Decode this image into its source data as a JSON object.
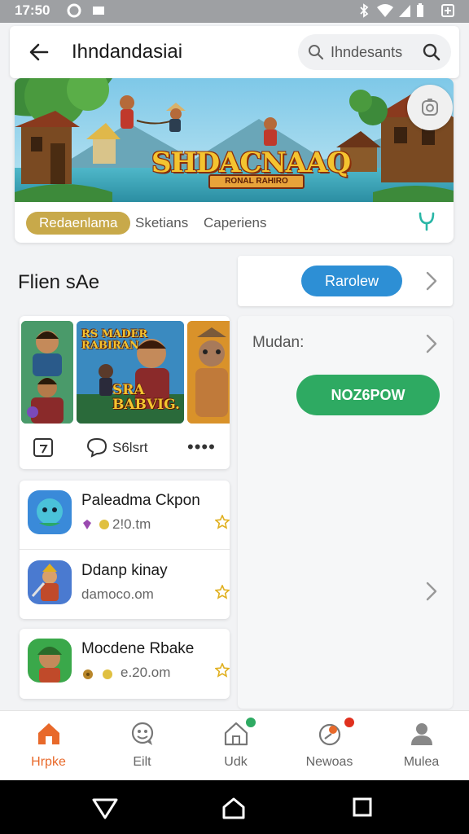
{
  "status_bar": {
    "time": "17:50"
  },
  "app_bar": {
    "title": "Ihndandasiai",
    "search_placeholder": "Ihndesants"
  },
  "banner": {
    "logo_text": "SHDACNAAQ",
    "logo_sub": "RONAL RAHIRO"
  },
  "tabs": [
    {
      "label": "Redaenlama",
      "active": true
    },
    {
      "label": "Sketians",
      "active": false
    },
    {
      "label": "Caperiens",
      "active": false
    }
  ],
  "section": {
    "title": "Flien sAe",
    "preview_button": "Rarolew"
  },
  "featured": {
    "thumb_caption_top": "RS MADER RABIRAN",
    "thumb_caption_bottom": "SRA BABVIG.",
    "stat_label": "S6lsrt",
    "more_label": "••••"
  },
  "media_panel": {
    "label": "Mudan:",
    "button": "NOZ6POW"
  },
  "apps": [
    {
      "name": "Paleadma Ckpon",
      "meta": "2!0.tm"
    },
    {
      "name": "Ddanp kinay",
      "meta": "damoco.om"
    },
    {
      "name": "Mocdene Rbake",
      "meta": "e.20.om"
    }
  ],
  "bottom_nav": [
    {
      "label": "Hrpke",
      "active": true
    },
    {
      "label": "Eilt",
      "active": false
    },
    {
      "label": "Udk",
      "active": false
    },
    {
      "label": "Newoas",
      "active": false
    },
    {
      "label": "Mulea",
      "active": false
    }
  ],
  "colors": {
    "accent_orange": "#e8692a",
    "tab_gold": "#c8a94a",
    "preview_blue": "#2d8fd5",
    "action_green": "#2eaa62"
  }
}
